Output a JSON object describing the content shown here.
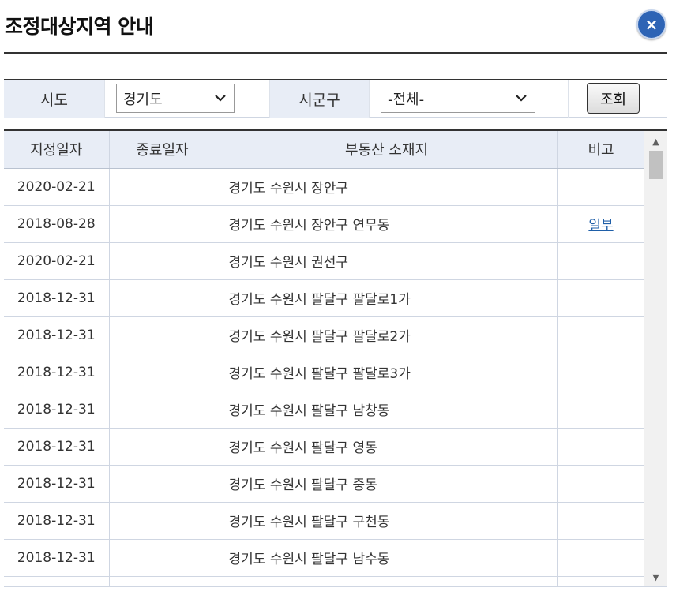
{
  "modal": {
    "title": "조정대상지역 안내",
    "close_label": "×"
  },
  "filter": {
    "sido_label": "시도",
    "sido_value": "경기도",
    "sigungu_label": "시군구",
    "sigungu_value": "-전체-",
    "search_label": "조회"
  },
  "table": {
    "columns": [
      "지정일자",
      "종료일자",
      "부동산 소재지",
      "비고"
    ],
    "rows": [
      {
        "start": "2020-02-21",
        "end": "",
        "address": "경기도 수원시 장안구",
        "note": ""
      },
      {
        "start": "2018-08-28",
        "end": "",
        "address": "경기도 수원시 장안구 연무동",
        "note": "일부"
      },
      {
        "start": "2020-02-21",
        "end": "",
        "address": "경기도 수원시 권선구",
        "note": ""
      },
      {
        "start": "2018-12-31",
        "end": "",
        "address": "경기도 수원시 팔달구 팔달로1가",
        "note": ""
      },
      {
        "start": "2018-12-31",
        "end": "",
        "address": "경기도 수원시 팔달구 팔달로2가",
        "note": ""
      },
      {
        "start": "2018-12-31",
        "end": "",
        "address": "경기도 수원시 팔달구 팔달로3가",
        "note": ""
      },
      {
        "start": "2018-12-31",
        "end": "",
        "address": "경기도 수원시 팔달구 남창동",
        "note": ""
      },
      {
        "start": "2018-12-31",
        "end": "",
        "address": "경기도 수원시 팔달구 영동",
        "note": ""
      },
      {
        "start": "2018-12-31",
        "end": "",
        "address": "경기도 수원시 팔달구 중동",
        "note": ""
      },
      {
        "start": "2018-12-31",
        "end": "",
        "address": "경기도 수원시 팔달구 구천동",
        "note": ""
      },
      {
        "start": "2018-12-31",
        "end": "",
        "address": "경기도 수원시 팔달구 남수동",
        "note": ""
      }
    ]
  },
  "icons": {
    "close": "close-icon",
    "dropdown": "chevron-down-icon",
    "scroll_up": "scroll-up-arrow-icon",
    "scroll_down": "scroll-down-arrow-icon"
  },
  "colors": {
    "accent": "#2e64b5",
    "header_bg": "#e8edf6",
    "link": "#1f5fa8"
  }
}
